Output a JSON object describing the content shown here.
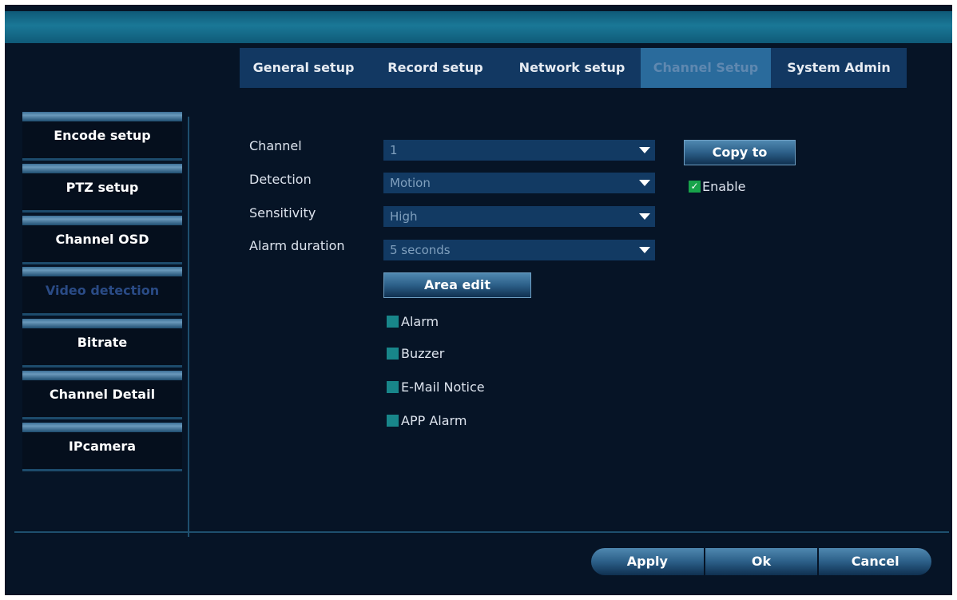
{
  "tabs": [
    {
      "label": "General setup"
    },
    {
      "label": "Record setup"
    },
    {
      "label": "Network setup"
    },
    {
      "label": "Channel Setup",
      "active": true
    },
    {
      "label": "System Admin"
    }
  ],
  "sidebar": {
    "items": [
      {
        "label": "Encode setup"
      },
      {
        "label": "PTZ setup"
      },
      {
        "label": "Channel OSD"
      },
      {
        "label": "Video detection",
        "active": true
      },
      {
        "label": "Bitrate"
      },
      {
        "label": "Channel Detail"
      },
      {
        "label": "IPcamera"
      }
    ]
  },
  "form": {
    "channel": {
      "label": "Channel",
      "value": "1"
    },
    "detection": {
      "label": "Detection",
      "value": "Motion"
    },
    "sensitivity": {
      "label": "Sensitivity",
      "value": "High"
    },
    "alarm_duration": {
      "label": "Alarm duration",
      "value": "5 seconds"
    },
    "copy_to_label": "Copy to",
    "enable_label": "Enable",
    "enable_checked": true,
    "area_edit_label": "Area edit",
    "checkboxes": [
      {
        "label": "Alarm",
        "checked": false
      },
      {
        "label": "Buzzer",
        "checked": false
      },
      {
        "label": "E-Mail Notice",
        "checked": false
      },
      {
        "label": "APP Alarm",
        "checked": false
      }
    ]
  },
  "footer": {
    "apply_label": "Apply",
    "ok_label": "Ok",
    "cancel_label": "Cancel"
  },
  "colors": {
    "background": "#061426",
    "tab_bar": "#123862",
    "active_tab": "#2a6b9c",
    "checkbox": "#18868a",
    "enable_checkbox": "#18a34a"
  },
  "icons": {
    "dropdown": "chevron-down-icon",
    "check": "check-icon"
  }
}
